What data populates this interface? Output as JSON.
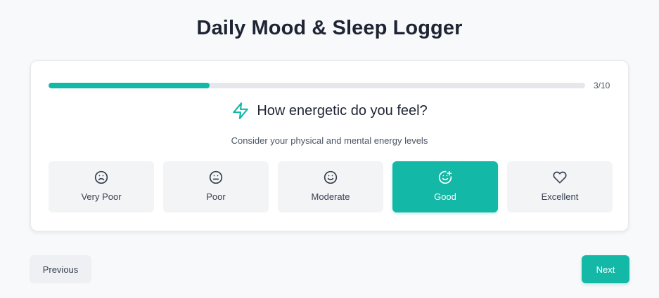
{
  "header": {
    "title": "Daily Mood & Sleep Logger"
  },
  "progress": {
    "current": 3,
    "total": 10,
    "label": "3/10",
    "fraction": 0.3
  },
  "question": {
    "icon": "lightning-icon",
    "text": "How energetic do you feel?",
    "hint": "Consider your physical and mental energy levels"
  },
  "options": [
    {
      "label": "Very Poor",
      "icon": "frown-icon",
      "selected": false
    },
    {
      "label": "Poor",
      "icon": "meh-icon",
      "selected": false
    },
    {
      "label": "Moderate",
      "icon": "smile-icon",
      "selected": false
    },
    {
      "label": "Good",
      "icon": "smile-plus-icon",
      "selected": true
    },
    {
      "label": "Excellent",
      "icon": "heart-icon",
      "selected": false
    }
  ],
  "nav": {
    "previous_label": "Previous",
    "next_label": "Next"
  },
  "colors": {
    "accent": "#14b8a6",
    "track": "#e5e7eb",
    "option_bg": "#f3f4f6"
  }
}
